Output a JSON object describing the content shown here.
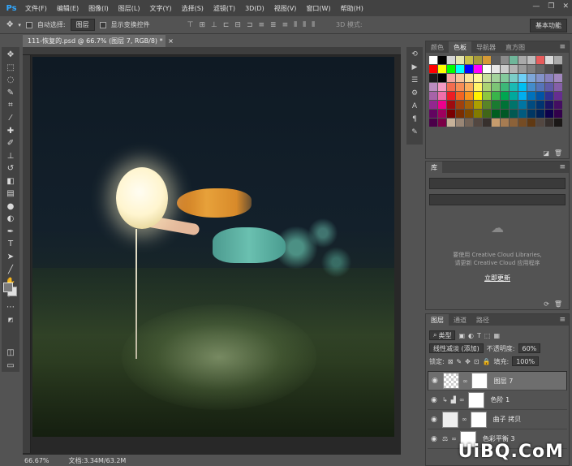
{
  "app": {
    "logo": "Ps"
  },
  "menu": [
    "文件(F)",
    "编辑(E)",
    "图像(I)",
    "图层(L)",
    "文字(Y)",
    "选择(S)",
    "滤镜(T)",
    "3D(D)",
    "视图(V)",
    "窗口(W)",
    "帮助(H)"
  ],
  "window_controls": [
    "—",
    "❐",
    "✕"
  ],
  "options": {
    "auto_select_label": "自动选择:",
    "auto_select_value": "图层",
    "transform_label": "显示变换控件",
    "mode_3d": "3D 模式:",
    "workspace": "基本功能"
  },
  "document": {
    "tab_title": "111-恢复的.psd @ 66.7% (图层 7, RGB/8) *",
    "close": "×"
  },
  "status": {
    "zoom": "66.67%",
    "doc_info": "文档:3.34M/63.2M"
  },
  "color_panel": {
    "tabs": [
      "颜色",
      "色板",
      "导航器",
      "直方图"
    ],
    "active": "色板"
  },
  "library_panel": {
    "tab": "库",
    "line1": "要使用 Creative Cloud Libraries,",
    "line2": "请更新 Creative Cloud 应用程序",
    "link": "立即更新"
  },
  "layers_panel": {
    "tabs": [
      "图层",
      "通道",
      "路径"
    ],
    "kind": "类型",
    "blend_mode": "线性减淡 (添加)",
    "opacity_label": "不透明度:",
    "opacity": "60%",
    "lock_label": "锁定:",
    "fill_label": "填充:",
    "fill": "100%",
    "layers": [
      {
        "name": "图层 7",
        "selected": true
      },
      {
        "name": "色阶 1",
        "selected": false
      },
      {
        "name": "曲子 拷贝",
        "selected": false
      },
      {
        "name": "色彩平衡 3",
        "selected": false
      }
    ]
  },
  "watermark": "UiBQ.CoM",
  "colors": {
    "accent": "#31a8ff",
    "panel_bg": "#535353",
    "dark_bg": "#424242"
  },
  "swatches": [
    "#ffffff",
    "#000000",
    "#d6d6d6",
    "#e6e6b0",
    "#c8c04a",
    "#a69a3a",
    "#d59a36",
    "#5b5b5b",
    "#8b8b8b",
    "#6fb69a",
    "#a9a9a9",
    "#bcbcbc",
    "#e85c5c",
    "#dadada",
    "#aaaaaa",
    "#ff0000",
    "#ffff00",
    "#00ff00",
    "#00ffff",
    "#0000ff",
    "#ff00ff",
    "#ffffff",
    "#e6e6e6",
    "#cccccc",
    "#b3b3b3",
    "#999999",
    "#808080",
    "#666666",
    "#4d4d4d",
    "#333333",
    "#1a1a1a",
    "#000000",
    "#f4a6a0",
    "#f7c49a",
    "#fbe49b",
    "#fff799",
    "#c6df9c",
    "#a3d39c",
    "#82ca9c",
    "#7bcdc8",
    "#6dcff6",
    "#7da7d9",
    "#8393ca",
    "#8781bd",
    "#a187be",
    "#bc8dbf",
    "#f49ac2",
    "#f26c4f",
    "#f68e56",
    "#fbaf5d",
    "#fff568",
    "#acd373",
    "#7cc576",
    "#3bb878",
    "#1abbb4",
    "#00bff3",
    "#438ccb",
    "#5574b9",
    "#605ca8",
    "#855fa8",
    "#a763a8",
    "#f06eaa",
    "#ed1c24",
    "#f26522",
    "#f7941d",
    "#fff200",
    "#8dc63f",
    "#39b54a",
    "#00a651",
    "#00a99d",
    "#00aeef",
    "#0072bc",
    "#0054a6",
    "#2e3192",
    "#662d91",
    "#92278f",
    "#ec008c",
    "#9e0b0f",
    "#a0410d",
    "#a36209",
    "#aba000",
    "#598527",
    "#1a7b30",
    "#007236",
    "#00746b",
    "#0076a3",
    "#004b80",
    "#003471",
    "#1b1464",
    "#440e62",
    "#630460",
    "#9e005d",
    "#790000",
    "#7b2e00",
    "#7d4900",
    "#827b00",
    "#406618",
    "#005e20",
    "#005826",
    "#005952",
    "#005b7f",
    "#003663",
    "#002157",
    "#0d004c",
    "#32004b",
    "#4b0049",
    "#7b0046",
    "#c7b299",
    "#998675",
    "#736357",
    "#534741",
    "#37302d",
    "#c69c6d",
    "#a67c52",
    "#8c6239",
    "#754c24",
    "#603913",
    "#534741",
    "#362f2d",
    "#1a1716"
  ]
}
